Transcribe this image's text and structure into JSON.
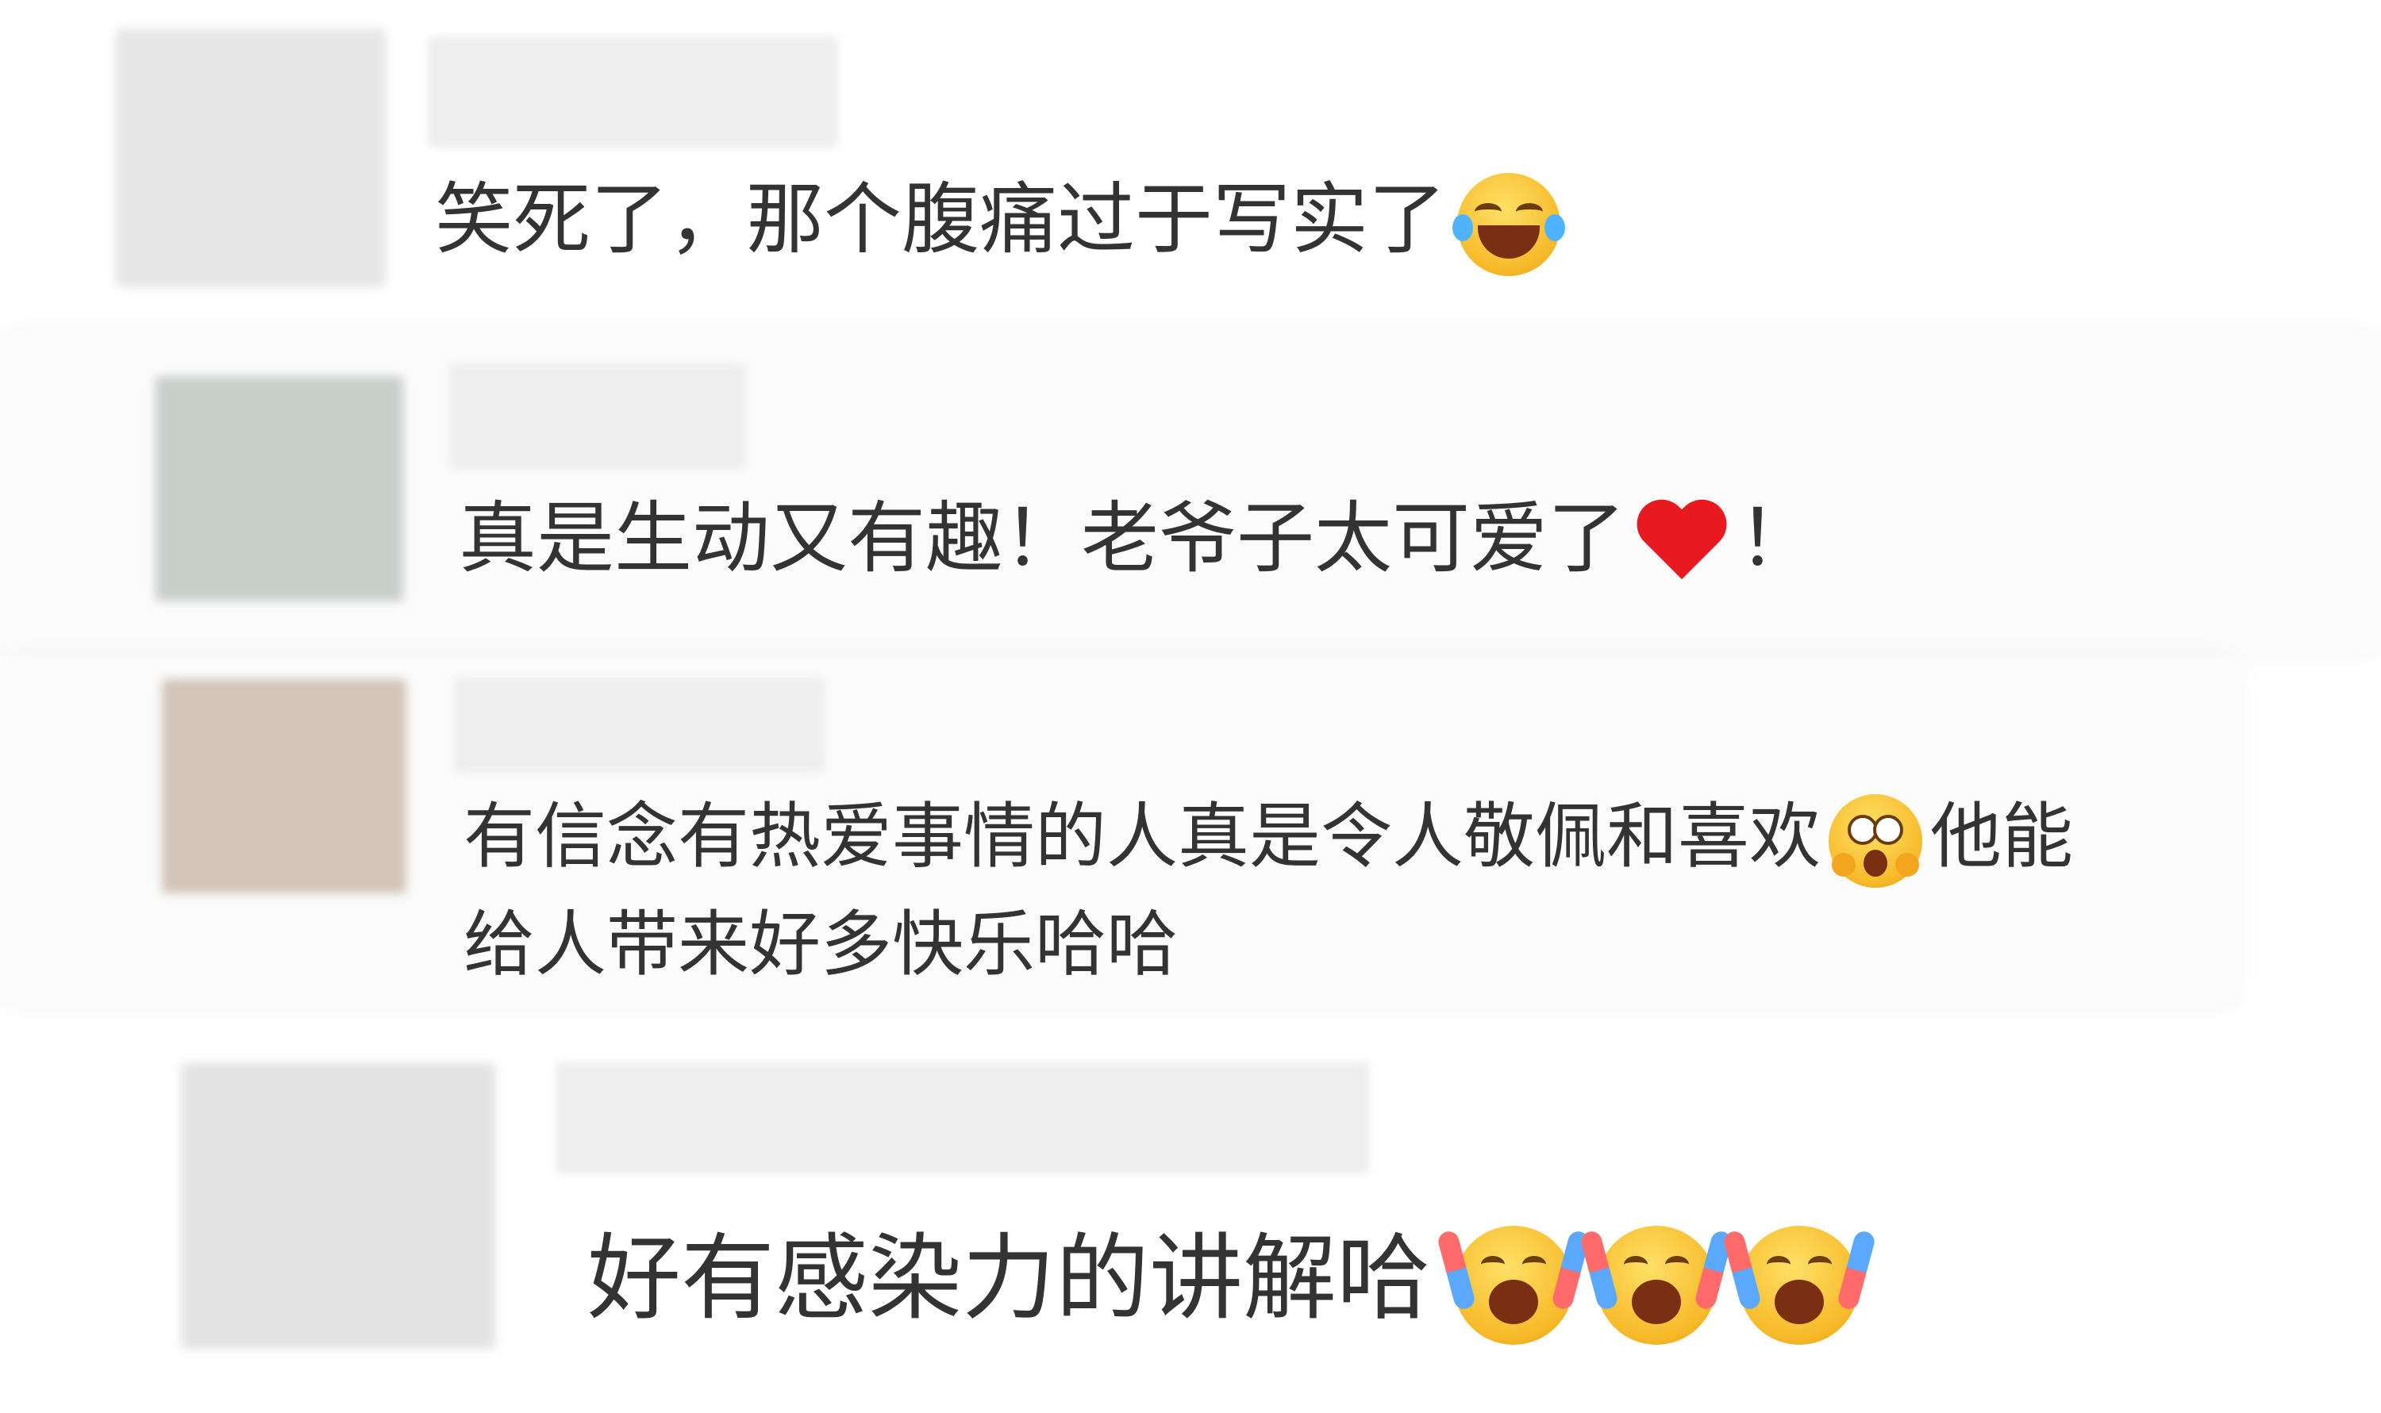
{
  "comments": [
    {
      "text": "笑死了，那个腹痛过于写实了",
      "emoji": [
        "laughing-crying-emoji"
      ],
      "avatar_color": "#e6e6e6"
    },
    {
      "text": "真是生动又有趣！老爷子太可爱了",
      "suffix": "！",
      "emoji": [
        "red-heart-emoji"
      ],
      "avatar_color": "#c8cfcb"
    },
    {
      "text_line1_a": "有信念有热爱事情的人真是令人敬佩和喜欢",
      "text_line1_b": "他能",
      "text_line2": "给人带来好多快乐哈哈",
      "emoji": [
        "amazed-emoji"
      ],
      "avatar_color": "#d2c4b8"
    },
    {
      "text": "好有感染力的讲解哈",
      "emoji": [
        "cheering-emoji",
        "cheering-emoji",
        "cheering-emoji"
      ],
      "avatar_color": "#e3e3e3"
    }
  ],
  "colors": {
    "text": "#333333",
    "heart": "#e8191f",
    "emoji_yellow": "#f7b928",
    "blur_placeholder": "#eeeeee"
  }
}
